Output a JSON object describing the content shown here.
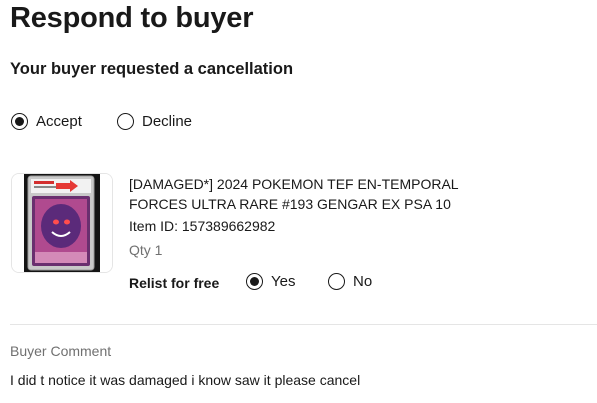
{
  "header": {
    "title": "Respond to buyer",
    "subtitle": "Your buyer requested a cancellation"
  },
  "response_choice": {
    "options": [
      {
        "label": "Accept",
        "selected": true
      },
      {
        "label": "Decline",
        "selected": false
      }
    ]
  },
  "item": {
    "title": "[DAMAGED*] 2024 POKEMON TEF EN-TEMPORAL FORCES ULTRA RARE #193 GENGAR EX PSA 10",
    "item_id": "Item ID: 157389662982",
    "qty": "Qty 1",
    "image_icon": "graded-card-photo"
  },
  "relist": {
    "label": "Relist for free",
    "options": [
      {
        "label": "Yes",
        "selected": true
      },
      {
        "label": "No",
        "selected": false
      }
    ]
  },
  "buyer_comment": {
    "heading": "Buyer Comment",
    "text": "I did t notice it was damaged i know saw it please cancel"
  },
  "colors": {
    "text": "#191919",
    "muted": "#707070",
    "divider": "#e5e5e5",
    "slab_label_red": "#d32f2f",
    "card_purple": "#8e4a9e"
  }
}
